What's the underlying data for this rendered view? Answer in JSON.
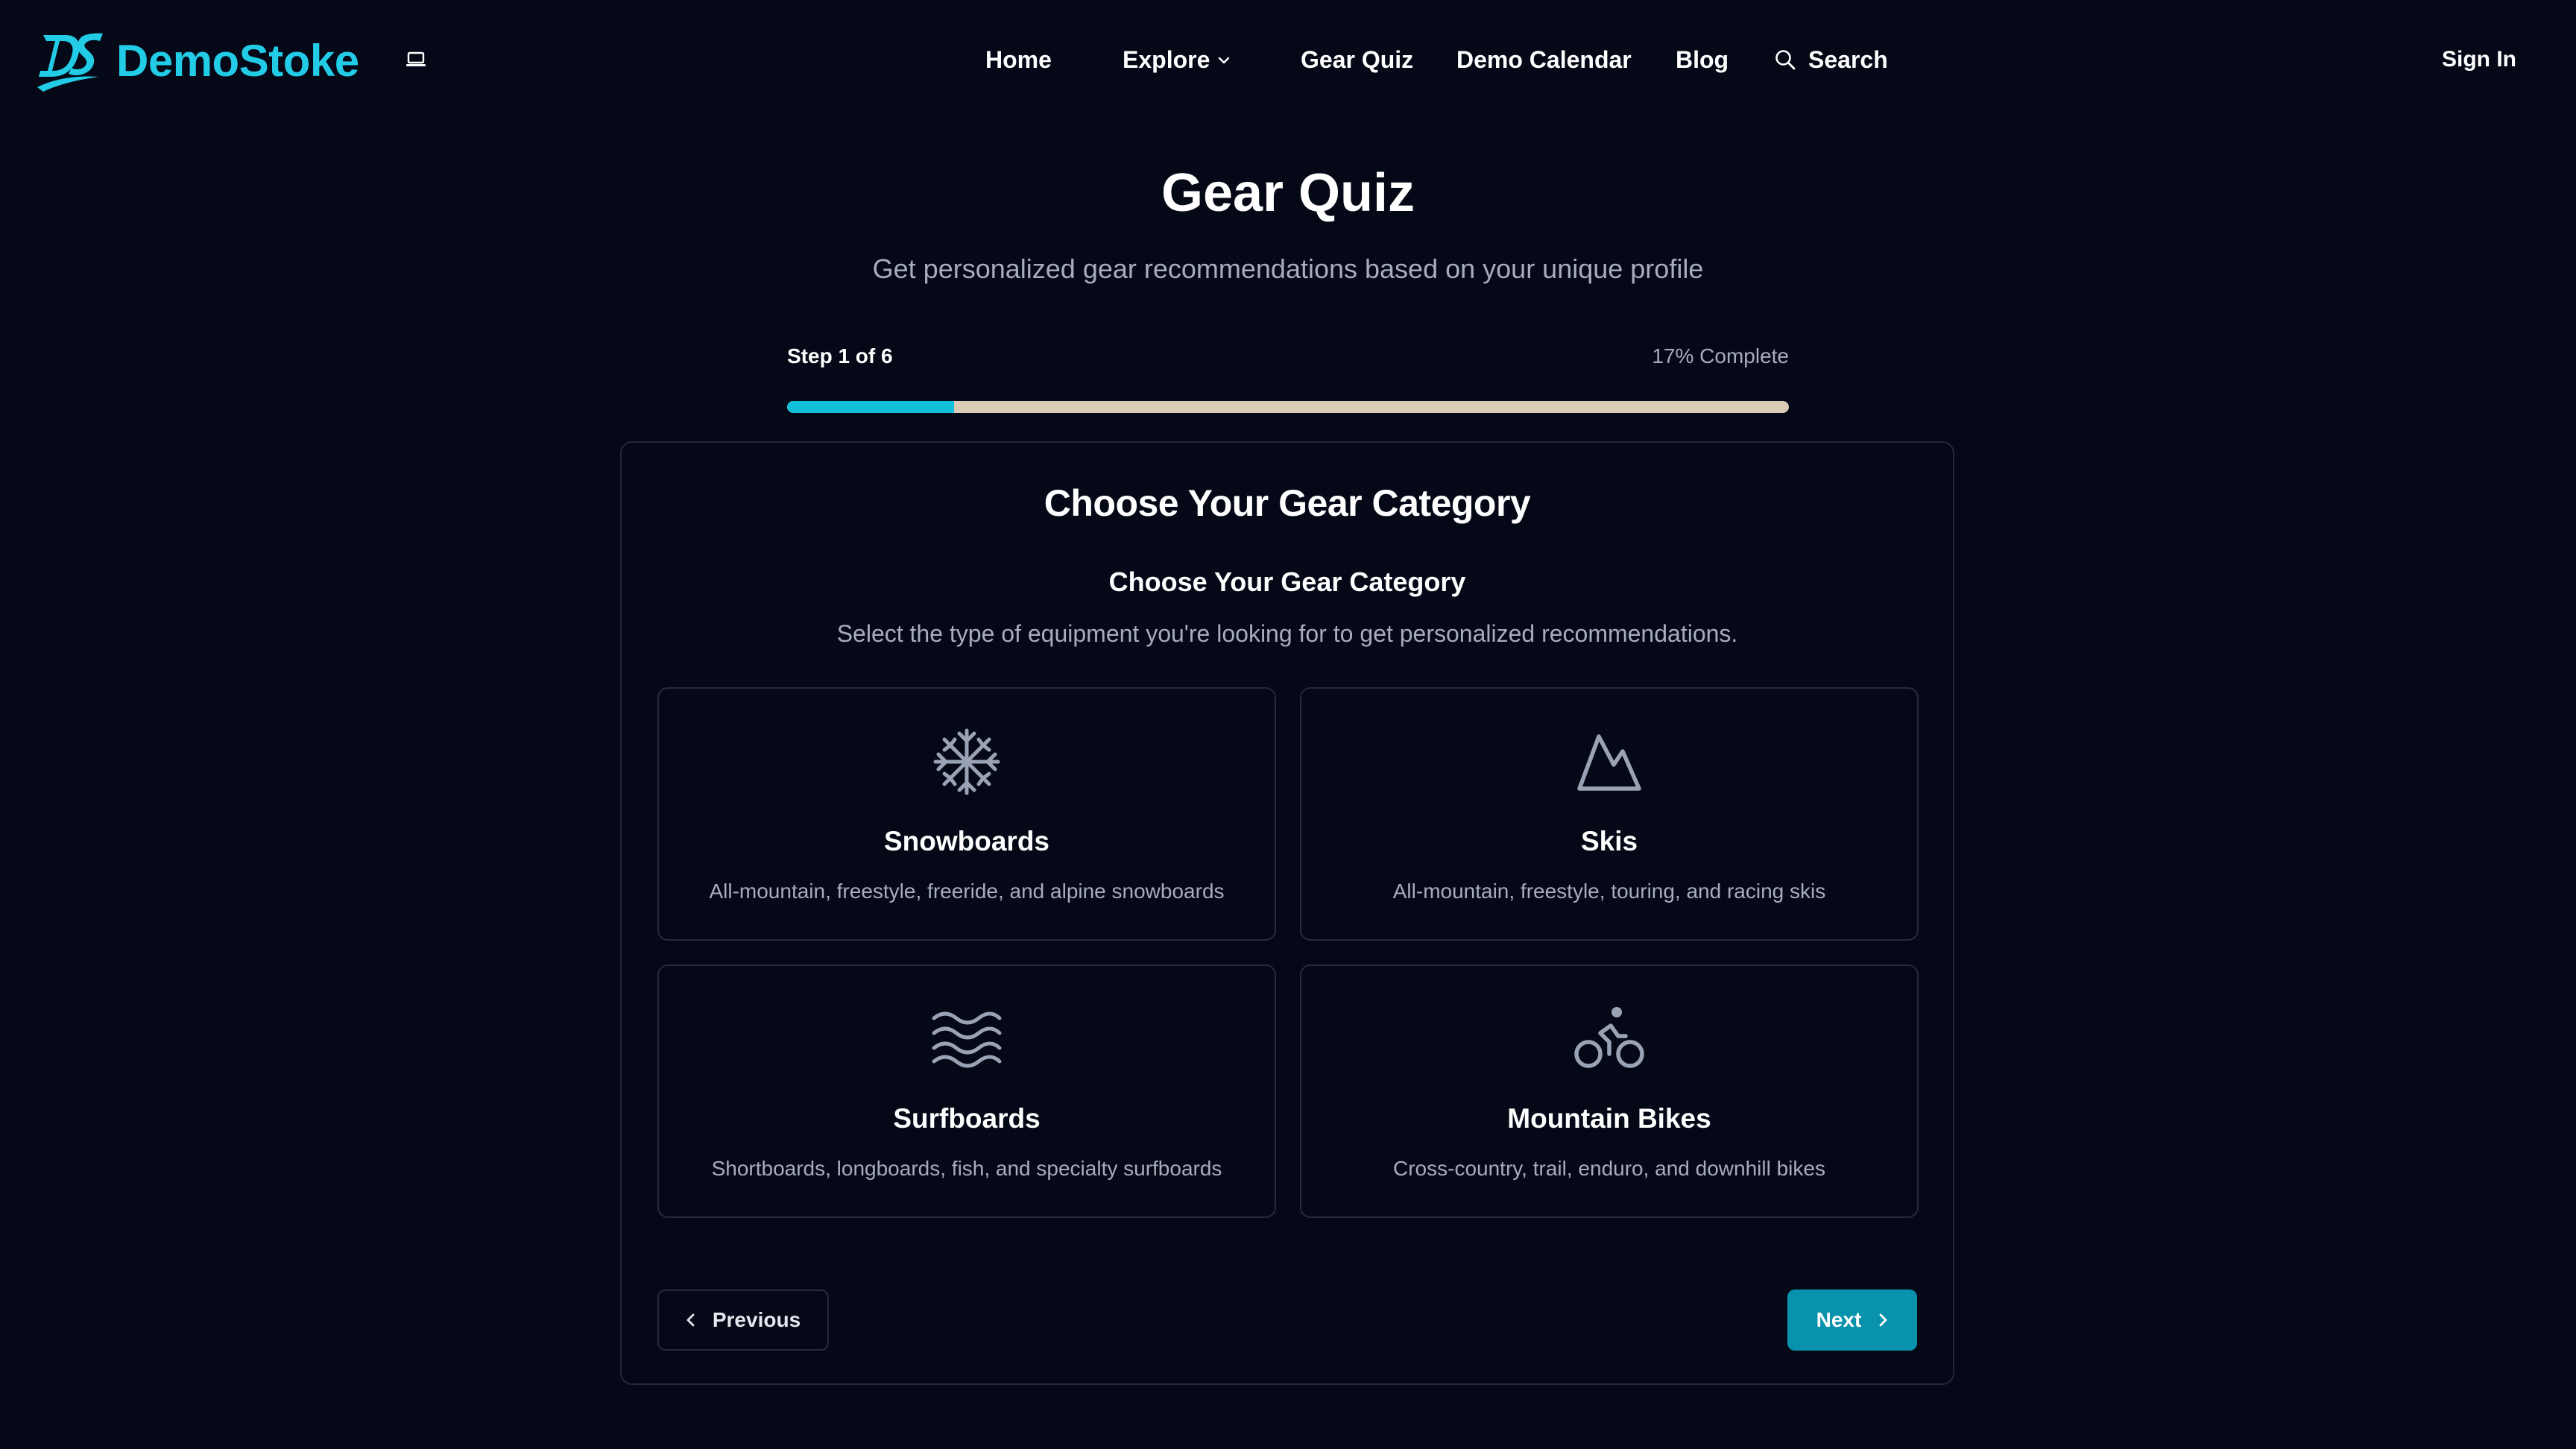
{
  "brand": {
    "name": "DemoStoke",
    "mark": "DS",
    "color": "#22cce6"
  },
  "theme_toggle": {
    "icon": "laptop-icon"
  },
  "nav": {
    "home": "Home",
    "explore": "Explore",
    "gear_quiz": "Gear Quiz",
    "demo_calendar": "Demo Calendar",
    "blog": "Blog",
    "search": "Search"
  },
  "auth": {
    "sign_in": "Sign In"
  },
  "page": {
    "title": "Gear Quiz",
    "subtitle": "Get personalized gear recommendations based on your unique profile"
  },
  "progress": {
    "step_label": "Step 1 of 6",
    "percent_label": "17% Complete",
    "current_step": 1,
    "total_steps": 6,
    "fraction": 0.167,
    "fill_color": "#11bfd9",
    "track_color": "#d9cbb5"
  },
  "quiz": {
    "card_title": "Choose Your Gear Category",
    "step_title": "Choose Your Gear Category",
    "step_description": "Select the type of equipment you're looking for to get personalized recommendations.",
    "options": [
      {
        "title": "Snowboards",
        "description": "All-mountain, freestyle, freeride, and alpine snowboards",
        "icon": "snowflake-icon"
      },
      {
        "title": "Skis",
        "description": "All-mountain, freestyle, touring, and racing skis",
        "icon": "mountain-icon"
      },
      {
        "title": "Surfboards",
        "description": "Shortboards, longboards, fish, and specialty surfboards",
        "icon": "waves-icon"
      },
      {
        "title": "Mountain Bikes",
        "description": "Cross-country, trail, enduro, and downhill bikes",
        "icon": "bike-icon"
      }
    ],
    "previous_label": "Previous",
    "next_label": "Next",
    "accent_color": "#0892ab"
  }
}
